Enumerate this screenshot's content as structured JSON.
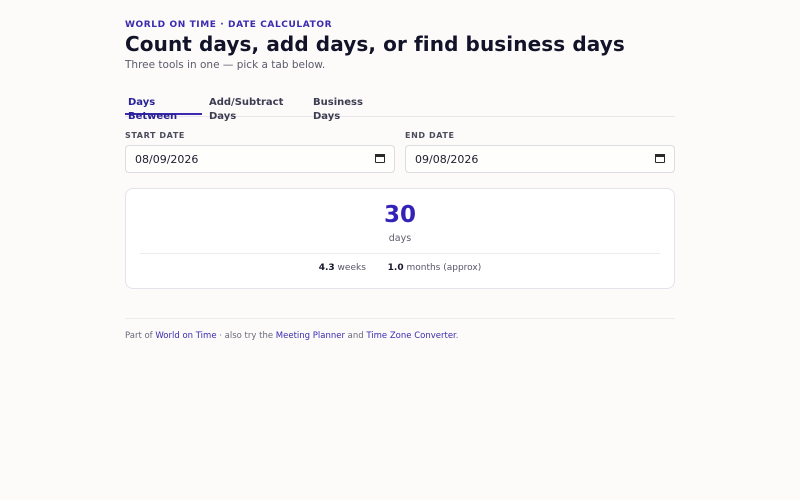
{
  "header": {
    "kicker": "WORLD ON TIME · DATE CALCULATOR",
    "title": "Count days, add days, or find business days",
    "subtitle": "Three tools in one — pick a tab below."
  },
  "tabs": [
    {
      "label": "Days Between",
      "active": true
    },
    {
      "label": "Add/Subtract Days",
      "active": false
    },
    {
      "label": "Business Days",
      "active": false
    }
  ],
  "form": {
    "start_label": "START DATE",
    "start_value": "08/09/2026",
    "end_label": "END DATE",
    "end_value": "09/08/2026"
  },
  "result": {
    "value": "30",
    "unit": "days",
    "weeks_value": "4.3",
    "weeks_label": "weeks",
    "months_value": "1.0",
    "months_label": "months (approx)"
  },
  "footer": {
    "prefix": "Part of",
    "link_home": "World on Time",
    "middle": "· also try the",
    "link_meeting": "Meeting Planner",
    "and": "and",
    "link_tz": "Time Zone Converter",
    "suffix": "."
  },
  "colors": {
    "accent": "#3a2bb0",
    "result_number": "#3322b8",
    "background": "#fcfbfa"
  },
  "icons": {
    "date_picker": "calendar-icon"
  }
}
